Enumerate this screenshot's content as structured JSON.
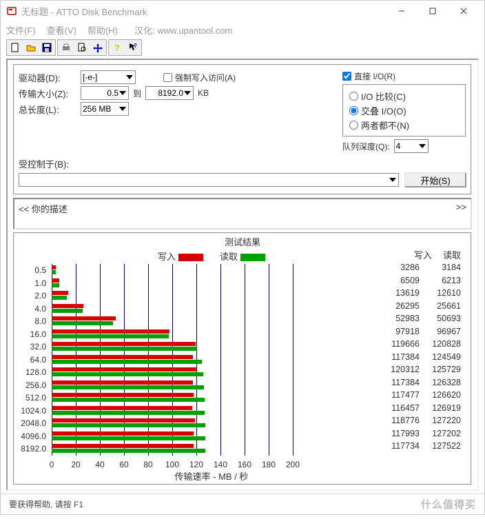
{
  "window": {
    "title": "无标题 - ATTO Disk Benchmark"
  },
  "menu": {
    "file": "文件(F)",
    "view": "查看(V)",
    "help": "帮助(H)",
    "cn": "汉化: www.upantool.com"
  },
  "labels": {
    "drive": "驱动器(D):",
    "transfer": "传输大小(Z):",
    "to": "到",
    "kb": "KB",
    "length": "总长度(L):",
    "force": "强制写入访问(A)",
    "direct": "直接 I/O(R)",
    "io_cmp": "I/O 比较(C)",
    "overlap": "交叠 I/O(O)",
    "neither": "两者都不(N)",
    "queue": "队列深度(Q):",
    "controlled": "受控制于(B):",
    "start": "开始(S)",
    "desc_l": "<<  你的描述",
    "desc_r": ">>",
    "result_title": "测试结果",
    "write": "写入",
    "read": "读取",
    "xaxis": "传输速率 - MB / 秒",
    "status": "要获得帮助, 请按 F1",
    "watermark": "什么值得买"
  },
  "values": {
    "drive": "[-e-]",
    "size_from": "0.5",
    "size_to": "8192.0",
    "length": "256 MB",
    "queue": "4",
    "force_checked": false,
    "direct_checked": true,
    "io_mode": "overlap"
  },
  "chart_data": {
    "type": "bar",
    "title": "测试结果",
    "xlabel": "传输速率 - MB / 秒",
    "xlim": [
      0,
      200
    ],
    "xticks": [
      0,
      20,
      40,
      60,
      80,
      100,
      120,
      140,
      160,
      180,
      200
    ],
    "categories": [
      "0.5",
      "1.0",
      "2.0",
      "4.0",
      "8.0",
      "16.0",
      "32.0",
      "64.0",
      "128.0",
      "256.0",
      "512.0",
      "1024.0",
      "2048.0",
      "4096.0",
      "8192.0"
    ],
    "series": [
      {
        "name": "写入",
        "color": "#d90000",
        "values": [
          3286,
          6509,
          13619,
          26295,
          52983,
          97918,
          119666,
          117384,
          120312,
          117384,
          117477,
          116457,
          118776,
          117993,
          117734
        ]
      },
      {
        "name": "读取",
        "color": "#00a000",
        "values": [
          3184,
          6213,
          12610,
          25661,
          50693,
          96967,
          120828,
          124549,
          125729,
          126328,
          126620,
          126919,
          127220,
          127202,
          127522
        ]
      }
    ]
  }
}
